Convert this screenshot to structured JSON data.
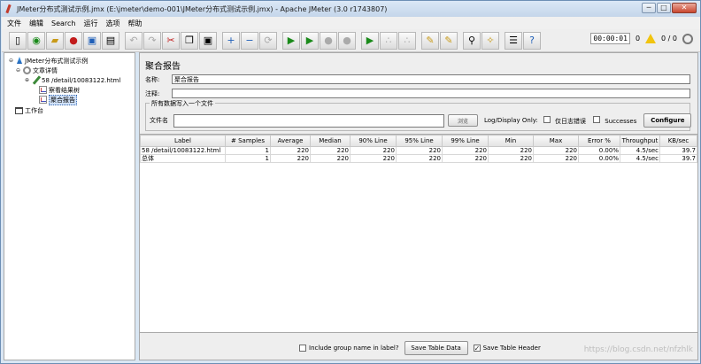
{
  "window": {
    "title": "JMeter分布式测试示例.jmx (E:\\jmeter\\demo-001\\JMeter分布式测试示例.jmx) - Apache JMeter (3.0 r1743807)",
    "controls": [
      "─",
      "□",
      "✕"
    ]
  },
  "menu": [
    "文件",
    "编辑",
    "Search",
    "运行",
    "选项",
    "帮助"
  ],
  "toolbar": {
    "timer": "00:00:01",
    "warnings": "0",
    "threads": "0 / 0"
  },
  "tree": {
    "plan": "JMeter分布式测试示例",
    "thread_group": "文章详情",
    "sampler": "58 /detail/10083122.html",
    "listener_tree": "察看结果树",
    "listener_agg": "聚合报告",
    "workbench": "工作台"
  },
  "main": {
    "title": "聚合报告",
    "name_label": "名称:",
    "name_value": "聚合报告",
    "comment_label": "注释:",
    "comment_value": "",
    "fieldset_legend": "所有数据写入一个文件",
    "filename_label": "文件名",
    "filename_value": "",
    "browse_label": "浏览",
    "log_display_label": "Log/Display Only:",
    "errors_only_label": "仅日志错误",
    "successes_label": "Successes",
    "configure_label": "Configure"
  },
  "table": {
    "columns": [
      "Label",
      "# Samples",
      "Average",
      "Median",
      "90% Line",
      "95% Line",
      "99% Line",
      "Min",
      "Max",
      "Error %",
      "Throughput",
      "KB/sec"
    ],
    "rows": [
      [
        "58 /detail/10083122.html",
        "1",
        "220",
        "220",
        "220",
        "220",
        "220",
        "220",
        "220",
        "0.00%",
        "4.5/sec",
        "39.7"
      ],
      [
        "总体",
        "1",
        "220",
        "220",
        "220",
        "220",
        "220",
        "220",
        "220",
        "0.00%",
        "4.5/sec",
        "39.7"
      ]
    ]
  },
  "footer": {
    "include_group_label": "Include group name in label?",
    "save_data_label": "Save Table Data",
    "save_header_label": "Save Table Header"
  },
  "watermark": "https://blog.csdn.net/nfzhlk"
}
